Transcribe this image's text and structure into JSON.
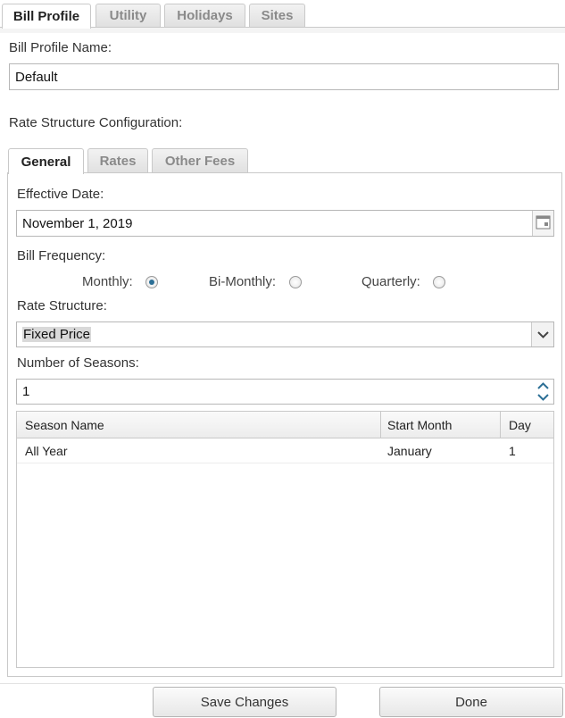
{
  "top_tabs": [
    "Bill Profile",
    "Utility",
    "Holidays",
    "Sites"
  ],
  "bill_profile_name": {
    "label": "Bill Profile Name:",
    "value": "Default"
  },
  "rate_structure_config_label": "Rate Structure Configuration:",
  "inner_tabs": [
    "General",
    "Rates",
    "Other Fees"
  ],
  "effective_date": {
    "label": "Effective Date:",
    "value": "November 1, 2019"
  },
  "bill_frequency": {
    "label": "Bill Frequency:",
    "options": [
      "Monthly:",
      "Bi-Monthly:",
      "Quarterly:"
    ],
    "selected": "Monthly:"
  },
  "rate_structure": {
    "label": "Rate Structure:",
    "value": "Fixed Price"
  },
  "number_of_seasons": {
    "label": "Number of Seasons:",
    "value": "1"
  },
  "seasons_table": {
    "columns": [
      "Season Name",
      "Start Month",
      "Day"
    ],
    "rows": [
      {
        "name": "All Year",
        "start_month": "January",
        "day": "1"
      }
    ]
  },
  "buttons": {
    "save": "Save Changes",
    "done": "Done"
  }
}
